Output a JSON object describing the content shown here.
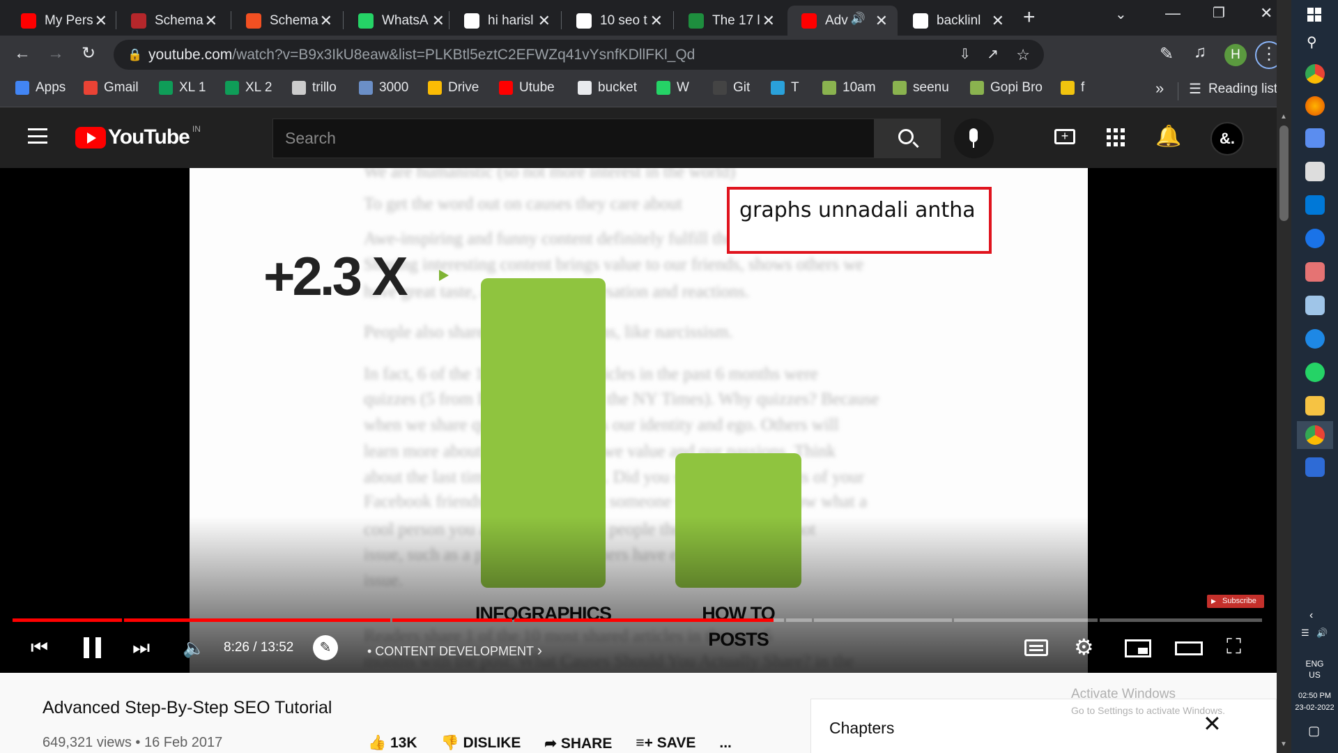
{
  "tabs": [
    {
      "label": "My Pers",
      "icon": "youtube-icon",
      "color": "#ff0000"
    },
    {
      "label": "Schema",
      "icon": "schema-org-icon",
      "color": "#b5272b"
    },
    {
      "label": "Schema",
      "icon": "microsoft-icon",
      "color": "#f25022"
    },
    {
      "label": "WhatsA",
      "icon": "whatsapp-icon",
      "color": "#25d366"
    },
    {
      "label": "hi harisl",
      "icon": "google-icon",
      "color": "#ffffff"
    },
    {
      "label": "10 seo t",
      "icon": "google-icon",
      "color": "#ffffff"
    },
    {
      "label": "The 17 l",
      "icon": "loading-icon",
      "color": "#1e8e3e"
    },
    {
      "label": "Adv",
      "icon": "youtube-icon",
      "color": "#ff0000"
    },
    {
      "label": "backlinl",
      "icon": "google-icon",
      "color": "#ffffff"
    }
  ],
  "omnibox": {
    "host": "youtube.com",
    "path": "/watch?v=B9x3IkU8eaw&list=PLKBtl5eztC2EFWZq41vYsnfKDllFKl_Qd"
  },
  "profile_initial": "H",
  "bookmarks": [
    {
      "label": "Apps",
      "color": "#4285f4"
    },
    {
      "label": "Gmail",
      "color": "#ea4335"
    },
    {
      "label": "XL 1",
      "color": "#0f9d58"
    },
    {
      "label": "XL 2",
      "color": "#0f9d58"
    },
    {
      "label": "trillo",
      "color": "#cccccc"
    },
    {
      "label": "3000",
      "color": "#6b8fc7"
    },
    {
      "label": "Drive",
      "color": "#fbbc04"
    },
    {
      "label": "Utube",
      "color": "#ff0000"
    },
    {
      "label": "bucket",
      "color": "#e8eaed"
    },
    {
      "label": "W",
      "color": "#25d366"
    },
    {
      "label": "Git",
      "color": "#444444"
    },
    {
      "label": "T",
      "color": "#2aa1da"
    },
    {
      "label": "10am",
      "color": "#8ab34f"
    },
    {
      "label": "seenu",
      "color": "#8ab34f"
    },
    {
      "label": "Gopi Bro",
      "color": "#8ab34f"
    },
    {
      "label": "f",
      "color": "#f1c40f"
    }
  ],
  "reading_list": "Reading list",
  "more_bookmarks": "»",
  "yt": {
    "logo": "YouTube",
    "region": "IN",
    "search_placeholder": "Search",
    "avatar": "&."
  },
  "slide": {
    "multiplier": "+2.3 X",
    "annotation": "graphs unnadali antha",
    "blur_lines": [
      "We are humanistic (so not more interest in the world)",
      "To get the word out on causes they care about",
      "Awe-inspiring and funny content definitely fulfill the first three reasons.",
      "Sharing interesting content brings value to our friends, shows others we",
      "have great taste, and sparks conversation and reactions.",
      "People also share for selfish reasons, like narcissism.",
      "In fact, 6 of the 10 most shared articles in the past 6 months were",
      "quizzes (5 from BuzzFeed, 1 from the NY Times). Why quizzes? Because",
      "when we share quiz results, it fuels our identity and ego. Others will",
      "learn more about us through what we value and our passions. Think",
      "about the last time you took a quiz. Did you share it? Lurk parts of your",
      "Facebook friends quizzes? No, but someone who does will know what a",
      "cool person you are. Sharing gives people the chance about a hot",
      "issue, such as a political debate others have expressed on the",
      "issue."
    ],
    "blur_bottom": "Readers share 1 of the 10 most shared articles in the past 6",
    "blur_bottom2": "months with the post: What Causes Should You Actually Share? in the"
  },
  "chart_data": {
    "type": "bar",
    "categories": [
      "INFOGRAPHICS",
      "HOW TO POSTS"
    ],
    "values": [
      2.3,
      1.0
    ],
    "title": "",
    "annotation": "+2.3 X",
    "colors": [
      "#8fc43f",
      "#8fc43f"
    ]
  },
  "player": {
    "time": "8:26 / 13:52",
    "chapter": "• CONTENT DEVELOPMENT",
    "subscribe": "Subscribe",
    "progress": 0.608
  },
  "video": {
    "title": "Advanced Step-By-Step SEO Tutorial",
    "meta": "649,321 views • 16 Feb 2017",
    "likes": "13K",
    "dislike": "DISLIKE",
    "share": "SHARE",
    "save": "SAVE",
    "more": "..."
  },
  "chapters": {
    "title": "Chapters"
  },
  "windows": {
    "activate_title": "Activate Windows",
    "activate_sub": "Go to Settings to activate Windows.",
    "lang1": "ENG",
    "lang2": "US",
    "time": "02:50 PM",
    "date": "23-02-2022"
  }
}
